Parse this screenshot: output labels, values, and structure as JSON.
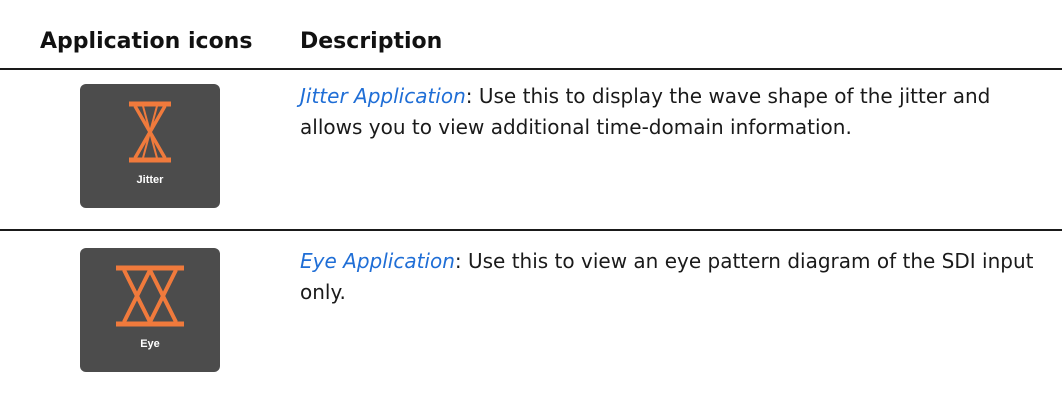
{
  "table": {
    "headers": {
      "icons": "Application icons",
      "description": "Description"
    },
    "rows": [
      {
        "icon_label": "Jitter",
        "icon_name": "jitter-app-icon",
        "link_text": "Jitter Application",
        "description": ": Use this to display the wave shape of the jitter and allows you to view additional time-domain information."
      },
      {
        "icon_label": "Eye",
        "icon_name": "eye-app-icon",
        "link_text": "Eye Application",
        "description": ": Use this to view an eye pattern diagram of the SDI input only."
      }
    ]
  },
  "colors": {
    "icon_background": "#4c4c4c",
    "icon_symbol": "#f07a3c",
    "link": "#1f6ed6"
  }
}
